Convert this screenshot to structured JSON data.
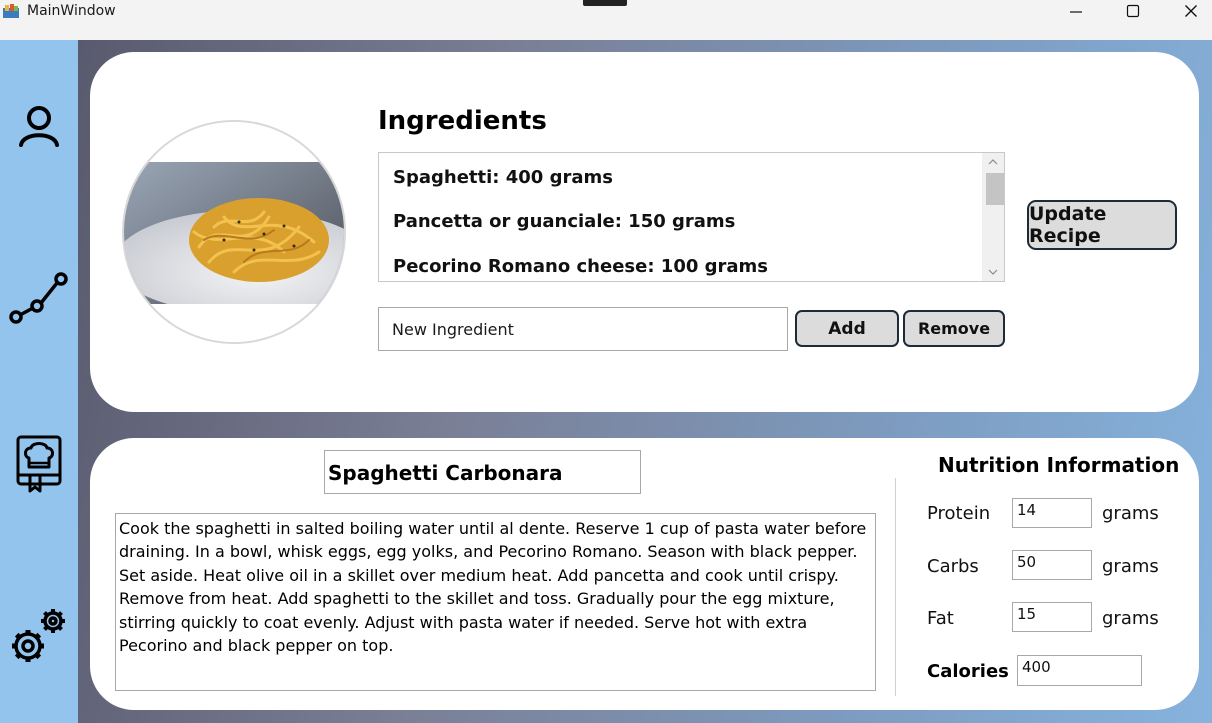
{
  "window": {
    "title": "MainWindow",
    "icons": {
      "app": "app-icon",
      "minimize": "minimize-icon",
      "maximize": "maximize-icon",
      "close": "close-icon"
    }
  },
  "sidebar": {
    "items": [
      {
        "name": "profile",
        "icon": "user-icon"
      },
      {
        "name": "graph",
        "icon": "graph-nodes-icon"
      },
      {
        "name": "recipe-book",
        "icon": "chef-book-icon"
      },
      {
        "name": "settings",
        "icon": "gears-icon"
      }
    ],
    "color": "#93c4ed"
  },
  "ingredients": {
    "title": "Ingredients",
    "items": [
      "Spaghetti: 400 grams",
      "Pancetta or guanciale: 150 grams",
      "Pecorino Romano cheese: 100 grams"
    ],
    "new_ingredient_value": "New Ingredient",
    "add_label": "Add",
    "remove_label": "Remove",
    "update_label": "Update Recipe"
  },
  "recipe": {
    "name": "Spaghetti Carbonara",
    "instructions": "Cook the spaghetti in salted boiling water until al dente. Reserve 1 cup of pasta water before draining. In a bowl, whisk eggs, egg yolks, and Pecorino Romano. Season with black pepper. Set aside. Heat olive oil in a skillet over medium heat. Add pancetta and cook until crispy. Remove from heat. Add spaghetti to the skillet and toss. Gradually pour the egg mixture, stirring quickly to coat evenly. Adjust with pasta water if needed. Serve hot with extra Pecorino and black pepper on top."
  },
  "nutrition": {
    "title": "Nutrition Information",
    "protein_label": "Protein",
    "protein_value": "14",
    "carbs_label": "Carbs",
    "carbs_value": "50",
    "fat_label": "Fat",
    "fat_value": "15",
    "unit": "grams",
    "calories_label": "Calories",
    "calories_value": "400"
  }
}
